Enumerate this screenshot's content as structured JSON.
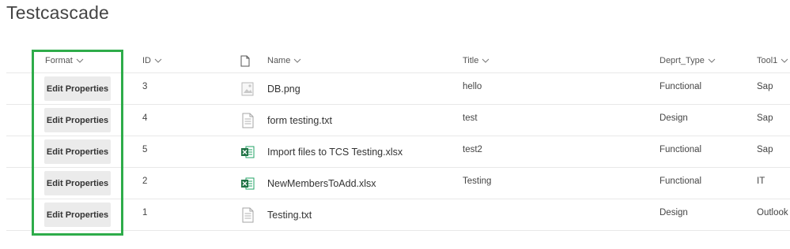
{
  "page": {
    "title": "Testcascade"
  },
  "columns": [
    {
      "key": "format",
      "label": "Format"
    },
    {
      "key": "id",
      "label": "ID"
    },
    {
      "key": "icon",
      "label": ""
    },
    {
      "key": "name",
      "label": "Name"
    },
    {
      "key": "title",
      "label": "Title"
    },
    {
      "key": "dept",
      "label": "Deprt_Type"
    },
    {
      "key": "tool",
      "label": "Tool1"
    }
  ],
  "rows": [
    {
      "action": "Edit Properties",
      "id": "3",
      "icon": "image-file-icon",
      "name": "DB.png",
      "title": "hello",
      "dept": "Functional",
      "tool": "Sap"
    },
    {
      "action": "Edit Properties",
      "id": "4",
      "icon": "text-file-icon",
      "name": "form testing.txt",
      "title": "test",
      "dept": "Design",
      "tool": "Sap"
    },
    {
      "action": "Edit Properties",
      "id": "5",
      "icon": "excel-file-icon",
      "name": "Import files to TCS Testing.xlsx",
      "title": "test2",
      "dept": "Functional",
      "tool": "Sap"
    },
    {
      "action": "Edit Properties",
      "id": "2",
      "icon": "excel-file-icon",
      "name": "NewMembersToAdd.xlsx",
      "title": "Testing",
      "dept": "Functional",
      "tool": "IT"
    },
    {
      "action": "Edit Properties",
      "id": "1",
      "icon": "text-file-icon",
      "name": "Testing.txt",
      "title": "",
      "dept": "Design",
      "tool": "Outlook"
    }
  ],
  "colors": {
    "highlight": "#2eac4a",
    "excel": "#217346",
    "button_bg": "#ebebeb"
  }
}
